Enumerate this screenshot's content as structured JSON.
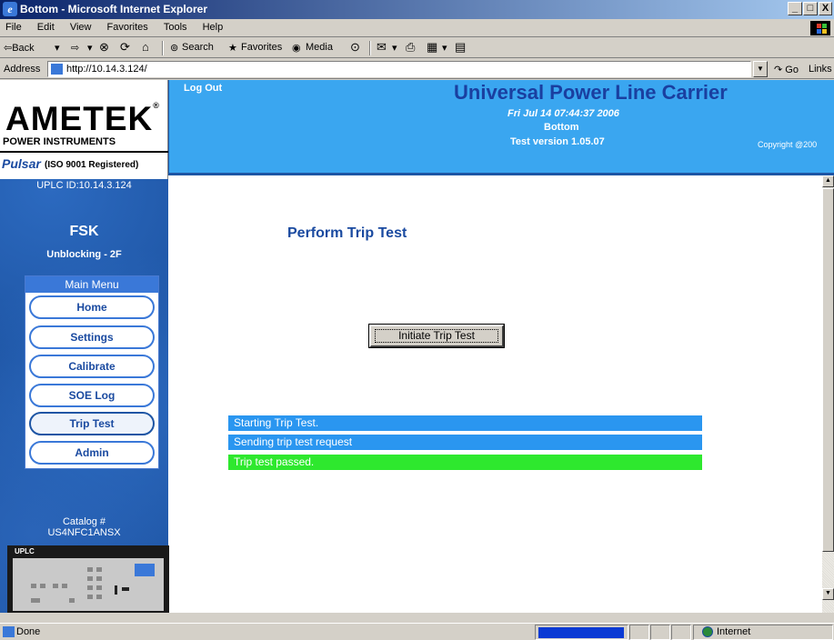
{
  "window": {
    "title": "Bottom - Microsoft Internet Explorer",
    "controls": [
      "_",
      "□",
      "X"
    ]
  },
  "menubar": {
    "items": [
      "File",
      "Edit",
      "View",
      "Favorites",
      "Tools",
      "Help"
    ]
  },
  "toolbar": {
    "back": "⇦Back",
    "forward": "⇨",
    "stop": "⊗",
    "refresh": "⟳",
    "home": "⌂",
    "search": "Search",
    "favorites": "Favorites",
    "media": "Media",
    "history": "⊙",
    "mail": "✉",
    "print": "⎙",
    "edit": "▦",
    "discuss": "▤"
  },
  "address": {
    "label": "Address",
    "url": "http://10.14.3.124/",
    "go": "Go",
    "links": "Links"
  },
  "sidebar": {
    "logo_brand": "AMETEK",
    "logo_sub": "POWER INSTRUMENTS",
    "logo_pulsar": "Pulsar",
    "logo_iso": "(ISO 9001 Registered)",
    "uplc_id": "UPLC ID:10.14.3.124",
    "mode": "FSK",
    "scheme": "Unblocking - 2F",
    "menu_title": "Main Menu",
    "menu_items": [
      "Home",
      "Settings",
      "Calibrate",
      "SOE Log",
      "Trip Test",
      "Admin"
    ],
    "active_item": "Trip Test",
    "catalog_label": "Catalog #",
    "catalog_value": "US4NFC1ANSX",
    "device_label": "UPLC"
  },
  "banner": {
    "logout": "Log Out",
    "title": "Universal Power Line Carrier",
    "timestamp": "Fri Jul 14 07:44:37 2006",
    "location": "Bottom",
    "version": "Test version 1.05.07",
    "copyright": "Copyright @200"
  },
  "main": {
    "title": "Perform Trip Test",
    "initiate_button": "Initiate Trip Test",
    "status_lines": [
      {
        "text": "Starting Trip Test.",
        "color": "#2a96f0"
      },
      {
        "text": "Sending trip test request",
        "color": "#2a96f0"
      },
      {
        "text": "Trip test passed.",
        "color": "#2ee82e"
      }
    ]
  },
  "statusbar": {
    "status": "Done",
    "zone": "Internet"
  },
  "colors": {
    "accent": "#1e55a4",
    "banner": "#3aa6f0",
    "title_blue": "#1a3fa0"
  }
}
